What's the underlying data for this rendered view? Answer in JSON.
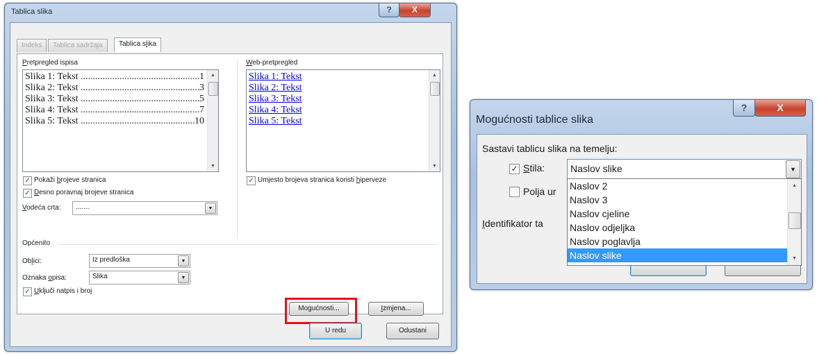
{
  "left_dialog": {
    "title": "Tablica slika",
    "help_btn": "?",
    "close_btn": "X",
    "tabs": [
      "Indeks",
      "Tablica sadržaja",
      "Tablica slika"
    ],
    "active_tab": 2,
    "print_preview_label_pre": "P",
    "print_preview_label_rest": "retpregled ispisa",
    "print_preview_items": [
      {
        "text": "Slika 1: Tekst",
        "page": "1"
      },
      {
        "text": "Slika 2: Tekst",
        "page": "3"
      },
      {
        "text": "Slika 3: Tekst",
        "page": "5"
      },
      {
        "text": "Slika 4: Tekst",
        "page": "7"
      },
      {
        "text": "Slika 5: Tekst",
        "page": "10"
      }
    ],
    "web_preview_label_pre": "W",
    "web_preview_label_rest": "eb-pretpregled",
    "web_preview_items": [
      "Slika 1: Tekst",
      "Slika 2: Tekst",
      "Slika 3: Tekst",
      "Slika 4: Tekst",
      "Slika 5: Tekst"
    ],
    "show_page_numbers_pre": "Pokaži ",
    "show_page_numbers_u": "b",
    "show_page_numbers_post": "rojeve stranica",
    "right_align_pre": "",
    "right_align_u": "D",
    "right_align_post": "esno poravnaj brojeve stranica",
    "leader_label_u": "V",
    "leader_label_post": "odeća crta:",
    "leader_value": ".......",
    "hyperlinks_pre": "Umjesto brojeva stranica koristi ",
    "hyperlinks_u": "h",
    "hyperlinks_post": "iperveze",
    "general_label": "Općenito",
    "format_label_pre": "Ob",
    "format_label_u": "l",
    "format_label_post": "ici:",
    "format_value": "Iz predloška",
    "caption_label_pre": "Oznaka ",
    "caption_label_u": "o",
    "caption_label_post": "pisa:",
    "caption_value": "Slika",
    "include_label_pre": "",
    "include_label_u": "U",
    "include_label_post": "ključi natpis i broj",
    "options_button": "Mogućnosti...",
    "modify_button_u": "I",
    "modify_button_post": "zmjena...",
    "ok_button": "U redu",
    "cancel_button": "Odustani"
  },
  "right_dialog": {
    "title": "Mogućnosti tablice slika",
    "help_btn": "?",
    "close_btn": "X",
    "build_label": "Sastavi tablicu slika na temelju:",
    "style_label_u": "S",
    "style_label_post": "tila:",
    "style_value": "Naslov slike",
    "fields_label": "Polja ur",
    "identifier_label_u": "I",
    "identifier_label_post": "dentifikator ta",
    "dropdown_options": [
      "Naslov 2",
      "Naslov 3",
      "Naslov cjeline",
      "Naslov odjeljka",
      "Naslov poglavlja",
      "Naslov slike"
    ],
    "selected_option": 5
  }
}
